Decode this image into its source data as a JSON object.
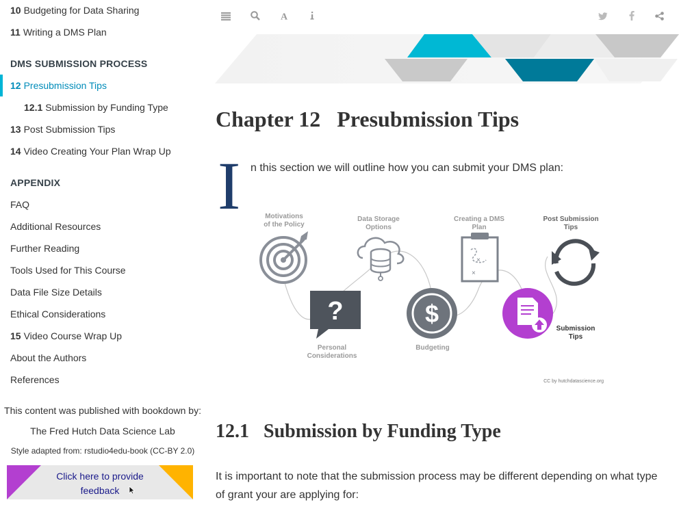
{
  "sidebar": {
    "items": [
      {
        "num": "10",
        "label": "Budgeting for Data Sharing"
      },
      {
        "num": "11",
        "label": "Writing a DMS Plan"
      },
      {
        "num": "12",
        "label": "Presubmission Tips"
      },
      {
        "num": "12.1",
        "label": "Submission by Funding Type"
      },
      {
        "num": "13",
        "label": "Post Submission Tips"
      },
      {
        "num": "14",
        "label": "Video Creating Your Plan Wrap Up"
      },
      {
        "num": "",
        "label": "FAQ"
      },
      {
        "num": "",
        "label": "Additional Resources"
      },
      {
        "num": "",
        "label": "Further Reading"
      },
      {
        "num": "",
        "label": "Tools Used for This Course"
      },
      {
        "num": "",
        "label": "Data File Size Details"
      },
      {
        "num": "",
        "label": "Ethical Considerations"
      },
      {
        "num": "15",
        "label": "Video Course Wrap Up"
      },
      {
        "num": "",
        "label": "About the Authors"
      },
      {
        "num": "",
        "label": "References"
      }
    ],
    "headers": {
      "dms": "DMS SUBMISSION PROCESS",
      "appendix": "APPENDIX"
    },
    "footer": {
      "published": "This content was published with bookdown by:",
      "lab": "The Fred Hutch Data Science Lab",
      "style": "Style adapted from: rstudio4edu-book (CC-BY 2.0)",
      "feedback": "Click here to provide feedback"
    }
  },
  "toolbar": {
    "icons": [
      "menu-icon",
      "search-icon",
      "font-icon",
      "info-icon",
      "twitter-icon",
      "facebook-icon",
      "share-icon"
    ]
  },
  "main": {
    "chapter_title": "Chapter 12   Presubmission Tips",
    "dropcap": "I",
    "intro": "n this section we will outline how you can submit your DMS plan:",
    "diagram": {
      "motivations": [
        "Motivations",
        "of the Policy"
      ],
      "storage": [
        "Data Storage",
        "Options"
      ],
      "creating": [
        "Creating a DMS",
        "Plan"
      ],
      "post": [
        "Post Submission",
        "Tips"
      ],
      "personal": [
        "Personal",
        "Considerations"
      ],
      "budgeting": "Budgeting",
      "submission": [
        "Submission",
        "Tips"
      ],
      "credit": "CC by hutchdatascience.org"
    },
    "section_title": "12.1   Submission by Funding Type",
    "paragraph": "It is important to note that the submission process may be different depending on what type of grant your are applying for:"
  },
  "colors": {
    "accent": "#00b5d6",
    "active_text": "#008cba",
    "purple": "#b33fd0",
    "navy": "#1f3d6b"
  }
}
